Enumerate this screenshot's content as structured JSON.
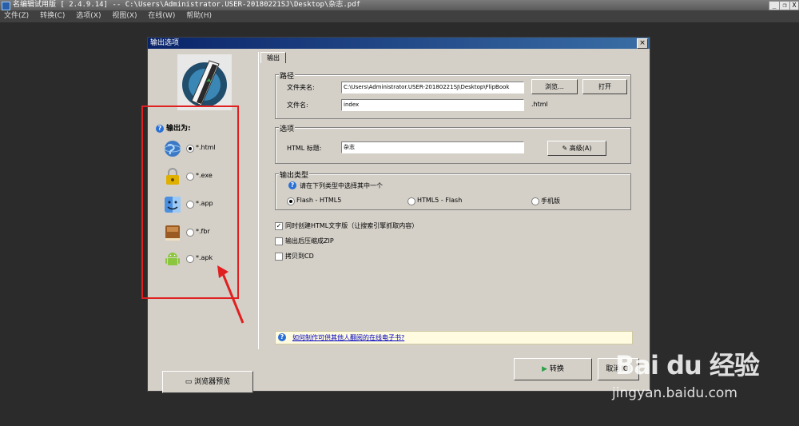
{
  "window": {
    "title": "名编辑试用版 [ 2.4.9.14] -- C:\\Users\\Administrator.USER-20180221SJ\\Desktop\\杂志.pdf",
    "min_label": "_",
    "restore_label": "❐",
    "close_label": "X"
  },
  "menu": [
    "文件(Z)",
    "转换(C)",
    "选项(X)",
    "视图(X)",
    "在线(W)",
    "帮助(H)"
  ],
  "dialog": {
    "title": "输出选项",
    "close_label": "×",
    "output_as_label": "输出为:",
    "output_options": [
      {
        "label": "*.html",
        "selected": true,
        "icon": "globe-icon"
      },
      {
        "label": "*.exe",
        "selected": false,
        "icon": "lock-icon"
      },
      {
        "label": "*.app",
        "selected": false,
        "icon": "mac-finder-icon"
      },
      {
        "label": "*.fbr",
        "selected": false,
        "icon": "book-icon"
      },
      {
        "label": "*.apk",
        "selected": false,
        "icon": "android-icon"
      }
    ],
    "preview_button": "浏览器预览",
    "tab": "输出",
    "path_group": {
      "title": "路径",
      "folder_label": "文件夹名:",
      "folder_value": "C:\\Users\\Administrator.USER-20180221SJ\\Desktop\\FlipBook",
      "browse_button": "浏览...",
      "open_button": "打开",
      "filename_label": "文件名:",
      "filename_value": "index",
      "extension": ".html"
    },
    "options_group": {
      "title": "选项",
      "html_title_label": "HTML 标题:",
      "html_title_value": "杂志",
      "advanced_button": "高级(A)"
    },
    "output_type_group": {
      "title": "输出类型",
      "hint": "请在下列类型中选择其中一个",
      "types": [
        {
          "label": "Flash - HTML5",
          "selected": true
        },
        {
          "label": "HTML5 - Flash",
          "selected": false
        },
        {
          "label": "手机版",
          "selected": false
        }
      ]
    },
    "checkboxes": [
      {
        "label": "同时创建HTML文字版（让搜索引擎抓取内容）",
        "checked": true
      },
      {
        "label": "输出后压缩成ZIP",
        "checked": false
      },
      {
        "label": "拷贝到CD",
        "checked": false
      }
    ],
    "tip_link": "如何制作可供其他人翻阅的在线电子书?",
    "convert_button": "转换",
    "cancel_button": "取消(C)"
  },
  "watermark": {
    "brand": "Bai du 经验",
    "site": "jingyan.baidu.com"
  }
}
